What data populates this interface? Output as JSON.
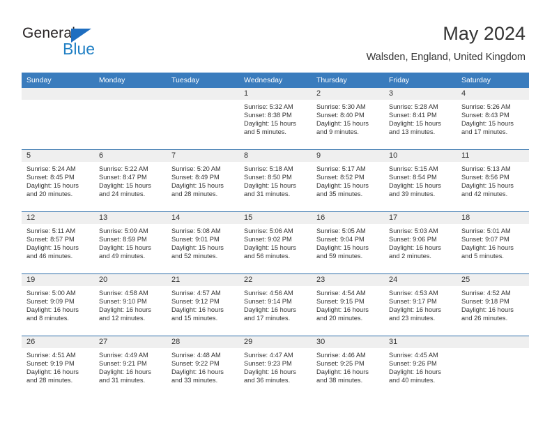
{
  "brand": {
    "name_part1": "General",
    "name_part2": "Blue"
  },
  "header": {
    "title": "May 2024",
    "subtitle": "Walsden, England, United Kingdom"
  },
  "colors": {
    "header_blue": "#3a7cbd",
    "row_rule": "#2b6ca8",
    "daynum_bg": "#efefef",
    "logo_blue": "#1f7fc4",
    "text": "#333333"
  },
  "weekdays": [
    "Sunday",
    "Monday",
    "Tuesday",
    "Wednesday",
    "Thursday",
    "Friday",
    "Saturday"
  ],
  "labels": {
    "sunrise": "Sunrise:",
    "sunset": "Sunset:",
    "daylight": "Daylight:"
  },
  "weeks": [
    [
      {
        "day": "",
        "empty": true
      },
      {
        "day": "",
        "empty": true
      },
      {
        "day": "",
        "empty": true
      },
      {
        "day": "1",
        "sunrise": "Sunrise: 5:32 AM",
        "sunset": "Sunset: 8:38 PM",
        "daylight1": "Daylight: 15 hours",
        "daylight2": "and 5 minutes."
      },
      {
        "day": "2",
        "sunrise": "Sunrise: 5:30 AM",
        "sunset": "Sunset: 8:40 PM",
        "daylight1": "Daylight: 15 hours",
        "daylight2": "and 9 minutes."
      },
      {
        "day": "3",
        "sunrise": "Sunrise: 5:28 AM",
        "sunset": "Sunset: 8:41 PM",
        "daylight1": "Daylight: 15 hours",
        "daylight2": "and 13 minutes."
      },
      {
        "day": "4",
        "sunrise": "Sunrise: 5:26 AM",
        "sunset": "Sunset: 8:43 PM",
        "daylight1": "Daylight: 15 hours",
        "daylight2": "and 17 minutes."
      }
    ],
    [
      {
        "day": "5",
        "sunrise": "Sunrise: 5:24 AM",
        "sunset": "Sunset: 8:45 PM",
        "daylight1": "Daylight: 15 hours",
        "daylight2": "and 20 minutes."
      },
      {
        "day": "6",
        "sunrise": "Sunrise: 5:22 AM",
        "sunset": "Sunset: 8:47 PM",
        "daylight1": "Daylight: 15 hours",
        "daylight2": "and 24 minutes."
      },
      {
        "day": "7",
        "sunrise": "Sunrise: 5:20 AM",
        "sunset": "Sunset: 8:49 PM",
        "daylight1": "Daylight: 15 hours",
        "daylight2": "and 28 minutes."
      },
      {
        "day": "8",
        "sunrise": "Sunrise: 5:18 AM",
        "sunset": "Sunset: 8:50 PM",
        "daylight1": "Daylight: 15 hours",
        "daylight2": "and 31 minutes."
      },
      {
        "day": "9",
        "sunrise": "Sunrise: 5:17 AM",
        "sunset": "Sunset: 8:52 PM",
        "daylight1": "Daylight: 15 hours",
        "daylight2": "and 35 minutes."
      },
      {
        "day": "10",
        "sunrise": "Sunrise: 5:15 AM",
        "sunset": "Sunset: 8:54 PM",
        "daylight1": "Daylight: 15 hours",
        "daylight2": "and 39 minutes."
      },
      {
        "day": "11",
        "sunrise": "Sunrise: 5:13 AM",
        "sunset": "Sunset: 8:56 PM",
        "daylight1": "Daylight: 15 hours",
        "daylight2": "and 42 minutes."
      }
    ],
    [
      {
        "day": "12",
        "sunrise": "Sunrise: 5:11 AM",
        "sunset": "Sunset: 8:57 PM",
        "daylight1": "Daylight: 15 hours",
        "daylight2": "and 46 minutes."
      },
      {
        "day": "13",
        "sunrise": "Sunrise: 5:09 AM",
        "sunset": "Sunset: 8:59 PM",
        "daylight1": "Daylight: 15 hours",
        "daylight2": "and 49 minutes."
      },
      {
        "day": "14",
        "sunrise": "Sunrise: 5:08 AM",
        "sunset": "Sunset: 9:01 PM",
        "daylight1": "Daylight: 15 hours",
        "daylight2": "and 52 minutes."
      },
      {
        "day": "15",
        "sunrise": "Sunrise: 5:06 AM",
        "sunset": "Sunset: 9:02 PM",
        "daylight1": "Daylight: 15 hours",
        "daylight2": "and 56 minutes."
      },
      {
        "day": "16",
        "sunrise": "Sunrise: 5:05 AM",
        "sunset": "Sunset: 9:04 PM",
        "daylight1": "Daylight: 15 hours",
        "daylight2": "and 59 minutes."
      },
      {
        "day": "17",
        "sunrise": "Sunrise: 5:03 AM",
        "sunset": "Sunset: 9:06 PM",
        "daylight1": "Daylight: 16 hours",
        "daylight2": "and 2 minutes."
      },
      {
        "day": "18",
        "sunrise": "Sunrise: 5:01 AM",
        "sunset": "Sunset: 9:07 PM",
        "daylight1": "Daylight: 16 hours",
        "daylight2": "and 5 minutes."
      }
    ],
    [
      {
        "day": "19",
        "sunrise": "Sunrise: 5:00 AM",
        "sunset": "Sunset: 9:09 PM",
        "daylight1": "Daylight: 16 hours",
        "daylight2": "and 8 minutes."
      },
      {
        "day": "20",
        "sunrise": "Sunrise: 4:58 AM",
        "sunset": "Sunset: 9:10 PM",
        "daylight1": "Daylight: 16 hours",
        "daylight2": "and 12 minutes."
      },
      {
        "day": "21",
        "sunrise": "Sunrise: 4:57 AM",
        "sunset": "Sunset: 9:12 PM",
        "daylight1": "Daylight: 16 hours",
        "daylight2": "and 15 minutes."
      },
      {
        "day": "22",
        "sunrise": "Sunrise: 4:56 AM",
        "sunset": "Sunset: 9:14 PM",
        "daylight1": "Daylight: 16 hours",
        "daylight2": "and 17 minutes."
      },
      {
        "day": "23",
        "sunrise": "Sunrise: 4:54 AM",
        "sunset": "Sunset: 9:15 PM",
        "daylight1": "Daylight: 16 hours",
        "daylight2": "and 20 minutes."
      },
      {
        "day": "24",
        "sunrise": "Sunrise: 4:53 AM",
        "sunset": "Sunset: 9:17 PM",
        "daylight1": "Daylight: 16 hours",
        "daylight2": "and 23 minutes."
      },
      {
        "day": "25",
        "sunrise": "Sunrise: 4:52 AM",
        "sunset": "Sunset: 9:18 PM",
        "daylight1": "Daylight: 16 hours",
        "daylight2": "and 26 minutes."
      }
    ],
    [
      {
        "day": "26",
        "sunrise": "Sunrise: 4:51 AM",
        "sunset": "Sunset: 9:19 PM",
        "daylight1": "Daylight: 16 hours",
        "daylight2": "and 28 minutes."
      },
      {
        "day": "27",
        "sunrise": "Sunrise: 4:49 AM",
        "sunset": "Sunset: 9:21 PM",
        "daylight1": "Daylight: 16 hours",
        "daylight2": "and 31 minutes."
      },
      {
        "day": "28",
        "sunrise": "Sunrise: 4:48 AM",
        "sunset": "Sunset: 9:22 PM",
        "daylight1": "Daylight: 16 hours",
        "daylight2": "and 33 minutes."
      },
      {
        "day": "29",
        "sunrise": "Sunrise: 4:47 AM",
        "sunset": "Sunset: 9:23 PM",
        "daylight1": "Daylight: 16 hours",
        "daylight2": "and 36 minutes."
      },
      {
        "day": "30",
        "sunrise": "Sunrise: 4:46 AM",
        "sunset": "Sunset: 9:25 PM",
        "daylight1": "Daylight: 16 hours",
        "daylight2": "and 38 minutes."
      },
      {
        "day": "31",
        "sunrise": "Sunrise: 4:45 AM",
        "sunset": "Sunset: 9:26 PM",
        "daylight1": "Daylight: 16 hours",
        "daylight2": "and 40 minutes."
      },
      {
        "day": "",
        "empty": true
      }
    ]
  ]
}
